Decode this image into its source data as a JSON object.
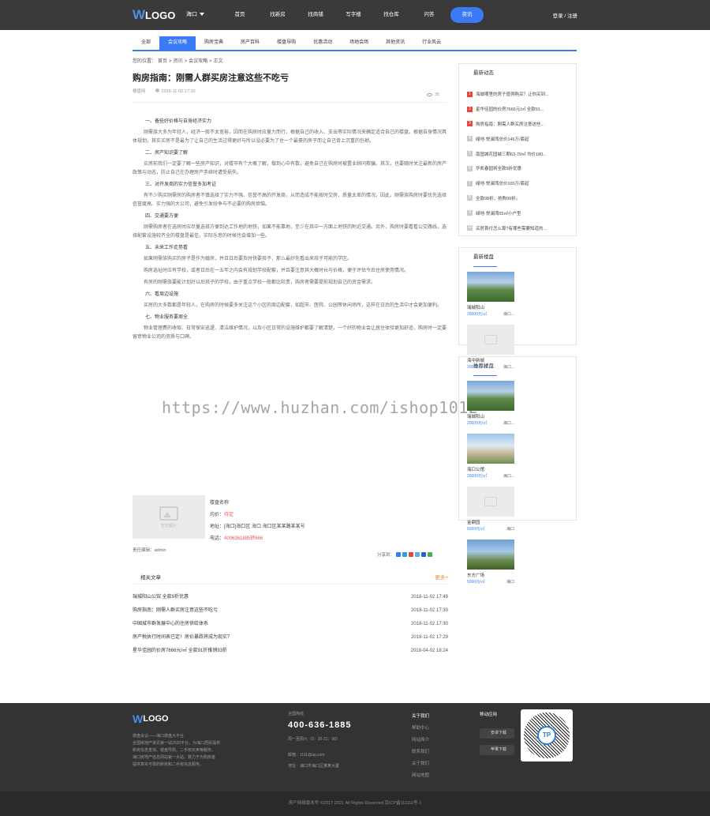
{
  "header": {
    "logo_mark": "W",
    "logo_text": "LOGO",
    "city": "海口",
    "nav": [
      "首页",
      "找新房",
      "找商铺",
      "写字楼",
      "找仓库",
      "问答",
      "资讯"
    ],
    "nav_active_index": 6,
    "login": "登录 / 注册",
    "accent_color": "#3a7bf5"
  },
  "subnav": {
    "items": [
      "全部",
      "会议攻略",
      "购房宝典",
      "房产百科",
      "楼盘导购",
      "优惠活动",
      "场地会场",
      "其他资讯",
      "行业风云"
    ],
    "active_index": 1
  },
  "breadcrumb": [
    "您的位置：",
    "首页",
    ">",
    "资讯",
    ">",
    "会议攻略",
    ">",
    "正文"
  ],
  "article": {
    "title": "购房指南：刚需人群买房注意这些不吃亏",
    "source": "楼盘网",
    "date": "2018-11-02 17:30",
    "views": "35",
    "sections": [
      {
        "h": "一、备些好价格与自身经济实力",
        "p": [
          "刚需族大多为年轻人，经济一般不太宽裕，因而在购房时应量力而行，根据自己的收入、支出等实际情况来确定适合自己的楼盘。根据自身情况具体规划，其实买房不是最为了让自己的生活过得更好与所以没必要为了住一个最豪的房子而让自己背上沉重的包袱。"
        ]
      },
      {
        "h": "二、房产知识要了解",
        "p": [
          "买房前我们一定要了解一些房产知识，对楼市有个大概了解，做到心中有数，避免自己在购房时被置业顾问欺骗。其次，也要随时关注最新的房产政策与动态，防止自己在办理房产手续时遭受损失。"
        ]
      },
      {
        "h": "三、对开发商的实力信誉多加考证",
        "p": [
          "有不少购买刚需房的购房者不慎选择了实力不强、信誉不高的开发商，从而造成不能按时交房、质量太差的情况。因此，刚需族购房时要优先选择信誉度高、实力强的大公司，避免引发纷争与不必要的购房烦恼。"
        ]
      },
      {
        "h": "四、交通要方便",
        "p": [
          "刚需购房者在选房时应尽量选择方便到达工作地的地铁，如果不能靠地，至少在其中一方面上地铁的附近交通。另外，购房时要看看公交路线，选择配套设施较齐全的楼盘是最佳，实际乐意的时候也会增加一些。"
        ]
      },
      {
        "h": "五、未来工作走势看",
        "p": [
          "如果刚需族购买的房子是作为婚房，并且日后要及时快要孩子，那么最好先看出来孩子可能的学区。",
          "购房选址时应有学校，或者日后在一五年之内会有规划学校配套，并且要注意其大概时长与价格，便于评估今后住房使用情况。",
          "有房的刚需族要能计划好以后孩子的学校，由于重点学校一般都比较贵，购房者需要提前规划自己的资金需求。"
        ]
      },
      {
        "h": "六、看周边设施",
        "p": [
          "买房的大多数都是年轻人，在购房的时候要多关注这个小区的周边配套，如超市、医院、公园等休闲场所，这样在日后的生活中才会更加便利。"
        ]
      },
      {
        "h": "七、物业服务要周全",
        "p": [
          "物业管理费的收取、日常保安巡逻、清洁维护情况，以及小区日常的设施维护都要了解清楚，一个好的物业会让居住体验更加舒适，购房时一定要留意物业公司的资质与口碑。"
        ]
      }
    ],
    "contact": {
      "placeholder_caption": "暂无图片",
      "name": "楼盘名称",
      "price_label": "均价：",
      "price_value": "待定",
      "address": "地址：[海口]海口区 海口 海口区某某路某某号",
      "phone_label": "电话：",
      "phone_value": "4006361885转666"
    },
    "author": "责任编辑：admin",
    "share_label": "分享到："
  },
  "related": {
    "title": "相关文章",
    "more": "更多+",
    "rows": [
      {
        "title": "瑞城阳山公馆 全款9折优惠",
        "date": "2018-11-02 17:48"
      },
      {
        "title": "购房指南：刚需人群买房注意这些不吃亏",
        "date": "2018-11-02 17:30"
      },
      {
        "title": "中国城市群发展中心的住房供给体系",
        "date": "2018-11-02 17:30"
      },
      {
        "title": "房产税执行时间表已定！房价暴跌将成为现实？",
        "date": "2018-11-02 17:29"
      },
      {
        "title": "星华佳园的价房7666元/㎡ 全款91折推销93折",
        "date": "2018-04-02 18:24"
      }
    ]
  },
  "sidebar": {
    "news_title": "最新动态",
    "news": [
      "海城哪里的房子值得购买？让你买到...",
      "星华佳园的价房7666元/㎡ 全款91...",
      "购房指南：刚需人群买房注意这些...",
      "绿地·悦澜湾总价146万/套起",
      "南国城花园城三期63-79㎡ 均价180...",
      "华凯春园将全款9折优惠",
      "绿地·悦澜湾总价100万/套起",
      "全款98折，抢购99折。",
      "绿地·悦澜湾55㎡小户型",
      "买房首付怎么算?有哪些需要知道的..."
    ],
    "hot_count": 3,
    "newest_title": "最新楼盘",
    "newest": [
      {
        "name": "瑞城阳山",
        "price": "20000元/㎡",
        "loc": "海口..."
      },
      {
        "name": "海中新城",
        "price": "20000元/㎡",
        "loc": "海口..."
      }
    ],
    "rec_title": "推荐楼盘",
    "rec": [
      {
        "name": "瑞城阳山",
        "price": "20000元/㎡",
        "loc": "海口..."
      },
      {
        "name": "海口公馆",
        "price": "20000元/㎡",
        "loc": "海口..."
      },
      {
        "name": "金鼎园",
        "price": "5000元/㎡",
        "loc": "海口"
      },
      {
        "name": "东方广场",
        "price": "5000元/㎡",
        "loc": "海口"
      }
    ]
  },
  "footer": {
    "logo_mark": "W",
    "logo_text": "LOGO",
    "desc": [
      "楼盘会议——海口楼盘大平台",
      "全国房地产资讯第一站2020平台，为海口居民提供",
      "新房信息查询、楼盘导购、二手房买卖等服务。",
      "海口房地产信息网站第一大站，致力于为购房者",
      "提供真实可靠的新房和二手房信息服务。"
    ],
    "hotline_label": "全国热线",
    "phone": "400-636-1885",
    "hours": "周一至周六（8：30-21：00）",
    "email": "邮箱：1111@qq.com",
    "address": "地址：海口市海口区某某大厦",
    "about_title": "关于我们",
    "about_links": [
      "帮助中心",
      "网站简介",
      "联系我们",
      "关于我们",
      "网站地图"
    ],
    "mobile_title": "移动应用",
    "android": "安卓下载",
    "ios": "苹果下载",
    "qr_text": "TP",
    "copyright": "房产网络版本号 ©2017-2021 All Rights Reserved 京ICP备111111号-1"
  }
}
